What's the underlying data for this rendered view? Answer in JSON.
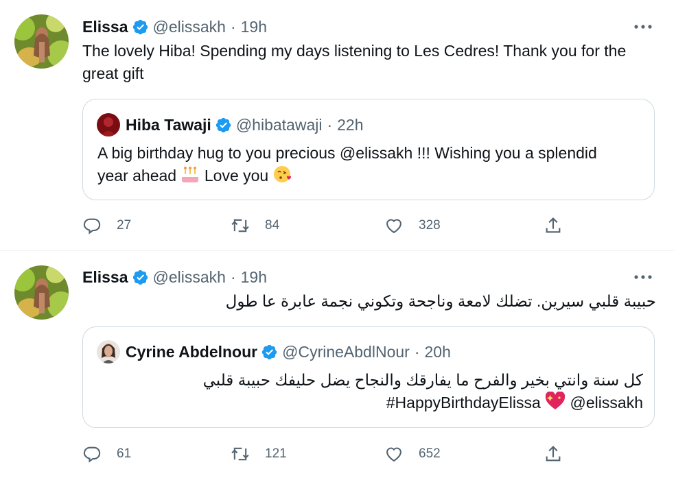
{
  "tweets": [
    {
      "author": {
        "name": "Elissa",
        "handle": "@elissakh",
        "time": "19h"
      },
      "text": "The lovely Hiba! Spending my days listening to Les Cedres! Thank you for the great gift",
      "quote": {
        "author": {
          "name": "Hiba Tawaji",
          "handle": "@hibatawaji",
          "time": "22h"
        },
        "line1": "A big birthday hug to you precious @elissakh !!! Wishing you a splendid",
        "line2_a": "year ahead",
        "line2_b": "Love you",
        "emoji1": "birthday-cake-emoji",
        "emoji2": "face-blowing-kiss-emoji"
      },
      "stats": {
        "replies": "27",
        "retweets": "84",
        "likes": "328"
      }
    },
    {
      "author": {
        "name": "Elissa",
        "handle": "@elissakh",
        "time": "19h"
      },
      "text": "حبيبة قلبي سيرين. تضلك لامعة وناجحة وتكوني نجمة عابرة عا طول",
      "quote": {
        "author": {
          "name": "Cyrine Abdelnour",
          "handle": "@CyrineAbdlNour",
          "time": "20h"
        },
        "line1": "كل سنة وانتي بخير والفرح ما يفارقك والنجاح يضل حليفك حبيبة قلبي",
        "mention": "@elissakh",
        "hashtag": "#HappyBirthdayElissa",
        "emoji1": "sparkling-heart-emoji"
      },
      "stats": {
        "replies": "61",
        "retweets": "121",
        "likes": "652"
      }
    }
  ],
  "icons": {
    "verified": "verified-badge-icon",
    "more": "more-options-icon",
    "reply": "reply-icon",
    "retweet": "retweet-icon",
    "like": "like-icon",
    "share": "share-icon"
  },
  "colors": {
    "text": "#0f1419",
    "secondary": "#536471",
    "verified": "#1d9bf0",
    "border": "#cfd9de",
    "divider": "#eff3f4"
  }
}
